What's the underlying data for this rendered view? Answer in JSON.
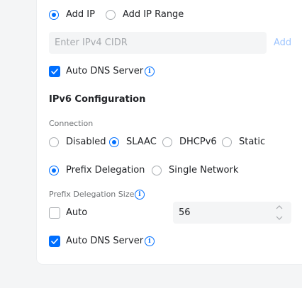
{
  "ipv4": {
    "radio_add_ip": "Add IP",
    "radio_add_ip_range": "Add IP Range",
    "cidr_placeholder": "Enter IPv4 CIDR",
    "add_link": "Add",
    "auto_dns_label": "Auto DNS Server"
  },
  "ipv6": {
    "title": "IPv6 Configuration",
    "connection_label": "Connection",
    "connection_options": [
      "Disabled",
      "SLAAC",
      "DHCPv6",
      "Static"
    ],
    "connection_selected": "SLAAC",
    "prefix_options": [
      "Prefix Delegation",
      "Single Network"
    ],
    "prefix_selected": "Prefix Delegation",
    "prefix_size_label": "Prefix Delegation Size",
    "auto_label": "Auto",
    "prefix_size_value": "56",
    "auto_dns_label": "Auto DNS Server"
  },
  "colors": {
    "accent": "#006fff",
    "add_link_disabled": "#9ec5ff",
    "input_bg": "#f4f5f6"
  }
}
